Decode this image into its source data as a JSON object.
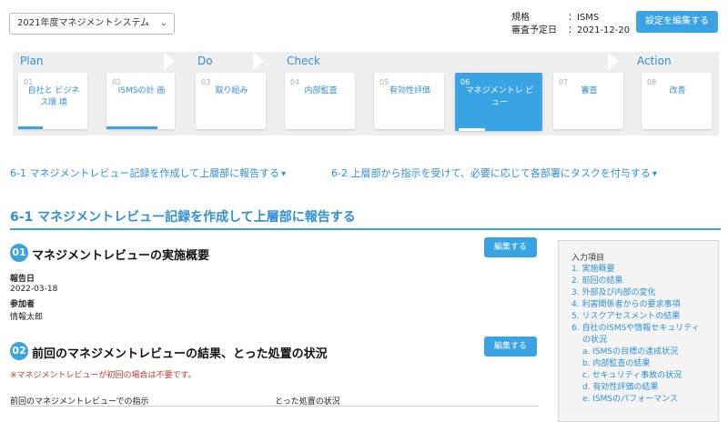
{
  "header": {
    "system_select": "2021年度マネジメントシステム",
    "standard_label": "規格",
    "standard_value": "：ISMS",
    "audit_label": "審査予定日",
    "audit_value": "：2021-12-20",
    "edit_settings": "設定を編集する"
  },
  "phases": [
    "Plan",
    "Do",
    "Check",
    "Action"
  ],
  "steps": [
    {
      "num": "01",
      "label": "自社と ビジネス環 境",
      "progress": 0.35
    },
    {
      "num": "02",
      "label": "ISMSの計 画",
      "progress": 0.75
    },
    {
      "num": "03",
      "label": "取り組み",
      "progress": 0
    },
    {
      "num": "04",
      "label": "内部監査",
      "progress": 0
    },
    {
      "num": "05",
      "label": "有効性評価",
      "progress": 0
    },
    {
      "num": "06",
      "label": "マネジメントレ ビュー",
      "progress": 0.3
    },
    {
      "num": "07",
      "label": "審査",
      "progress": 0
    },
    {
      "num": "08",
      "label": "改善",
      "progress": 0
    }
  ],
  "task_links": [
    "6-1 マネジメントレビュー記録を作成して上層部に報告する",
    "6-2 上層部から指示を受けて、必要に応じて各部署にタスクを付与する"
  ],
  "section_title": "6-1 マネジメントレビュー記録を作成して上層部に報告する",
  "item1": {
    "num": "01",
    "title": "マネジメントレビューの実施概要",
    "edit": "編集する",
    "report_date_label": "報告日",
    "report_date": "2022-03-18",
    "participants_label": "参加者",
    "participants": "情報太郎"
  },
  "item2": {
    "num": "02",
    "title": "前回のマネジメントレビューの結果、とった処置の状況",
    "edit": "編集する",
    "note": "※マネジメントレビューが初回の場合は不要です。",
    "col1": "前回のマネジメントレビューでの指示",
    "col2": "とった処置の状況"
  },
  "side": {
    "title": "入力項目",
    "items": [
      "1. 実施概要",
      "2. 前回の結果",
      "3. 外部及び内部の変化",
      "4. 利害関係者からの要求事項",
      "5. リスクアセスメントの結果",
      "6. 自社のISMSや情報セキュリティ",
      "の状況",
      "a. ISMSの目標の達成状況",
      "b. 内部監査の結果",
      "c. セキュリティ事故の状況",
      "d. 有効性評価の結果",
      "e. ISMSのパフォーマンス"
    ]
  }
}
